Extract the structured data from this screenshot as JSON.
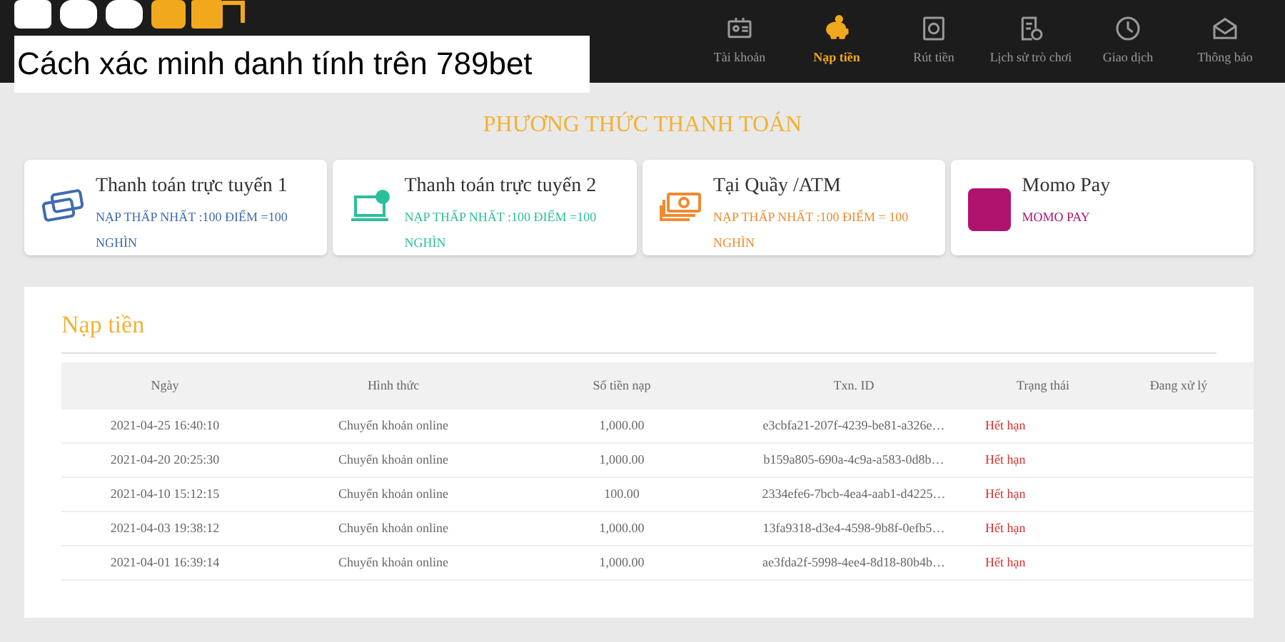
{
  "caption": "Cách xác minh danh tính trên 789bet",
  "nav": [
    {
      "label": "Tài khoản",
      "kind": "id",
      "selected": false
    },
    {
      "label": "Nạp tiền",
      "kind": "piggy",
      "selected": true
    },
    {
      "label": "Rút tiền",
      "kind": "safe",
      "selected": false
    },
    {
      "label": "Lịch sử trò chơi",
      "kind": "history",
      "selected": false
    },
    {
      "label": "Giao dịch",
      "kind": "clock",
      "selected": false
    },
    {
      "label": "Thông báo",
      "kind": "mail",
      "selected": false
    }
  ],
  "section_title": "PHƯƠNG THỨC THANH TOÁN",
  "methods": [
    {
      "title": "Thanh toán trực tuyến 1",
      "note": "NẠP THẤP NHẤT :100 ĐIỂM =100 NGHÌN",
      "kind": "cards",
      "color": "#3f6bb0"
    },
    {
      "title": "Thanh toán trực tuyến 2",
      "note": "NẠP THẤP NHẤT :100 ĐIỂM =100 NGHÌN",
      "kind": "laptop",
      "color": "#2bbf9a"
    },
    {
      "title": "Tại Quầy /ATM",
      "note": "NẠP THẤP NHẤT :100 ĐIỂM = 100 NGHÌN",
      "kind": "cash",
      "color": "#f08a30"
    },
    {
      "title": "Momo Pay",
      "note": "MOMO PAY",
      "kind": "momo",
      "color": "#b0136e"
    }
  ],
  "panel_title": "Nạp tiền",
  "table": {
    "columns": [
      "Ngày",
      "Hình thức",
      "Số tiền nạp",
      "Txn. ID",
      "Trạng thái",
      "Đang xử lý"
    ],
    "rows": [
      [
        "2021-04-25 16:40:10",
        "Chuyển khoản online",
        "1,000.00",
        "e3cbfa21-207f-4239-be81-a326e…",
        "Hết hạn"
      ],
      [
        "2021-04-20 20:25:30",
        "Chuyển khoản online",
        "1,000.00",
        "b159a805-690a-4c9a-a583-0d8b…",
        "Hết hạn"
      ],
      [
        "2021-04-10 15:12:15",
        "Chuyển khoản online",
        "100.00",
        "2334efe6-7bcb-4ea4-aab1-d4225…",
        "Hết hạn"
      ],
      [
        "2021-04-03 19:38:12",
        "Chuyển khoản online",
        "1,000.00",
        "13fa9318-d3e4-4598-9b8f-0efb5…",
        "Hết hạn"
      ],
      [
        "2021-04-01 16:39:14",
        "Chuyển khoản online",
        "1,000.00",
        "ae3fda2f-5998-4ee4-8d18-80b4b…",
        "Hết hạn"
      ]
    ]
  }
}
